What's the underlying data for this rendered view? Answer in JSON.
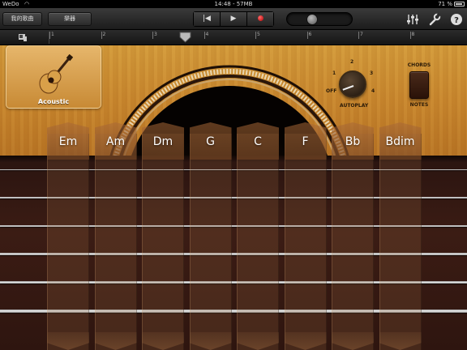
{
  "status_bar": {
    "carrier": "WeDo",
    "time": "14:48 - 57MB",
    "battery": "71 %"
  },
  "toolbar": {
    "songs_label": "我的歌曲",
    "instruments_label": "樂器",
    "transport": {
      "rewind_icon": "skip-back-icon",
      "play_icon": "play-icon",
      "record_icon": "record-icon"
    },
    "right_icons": [
      "mixer-icon",
      "wrench-icon",
      "help-icon"
    ]
  },
  "ruler": {
    "bars": [
      "1",
      "2",
      "3",
      "4",
      "5",
      "6",
      "7",
      "8"
    ]
  },
  "instrument": {
    "name": "Acoustic"
  },
  "autoplay": {
    "label": "AUTOPLAY",
    "positions": [
      "OFF",
      "1",
      "2",
      "3",
      "4"
    ],
    "value": 1
  },
  "mode_switch": {
    "top_label": "CHORDS",
    "bottom_label": "NOTES"
  },
  "chords": [
    "Em",
    "Am",
    "Dm",
    "G",
    "C",
    "F",
    "Bb",
    "Bdim"
  ],
  "colors": {
    "wood": "#c8862d",
    "fretboard": "#3b1c14",
    "record": "#d00000"
  }
}
